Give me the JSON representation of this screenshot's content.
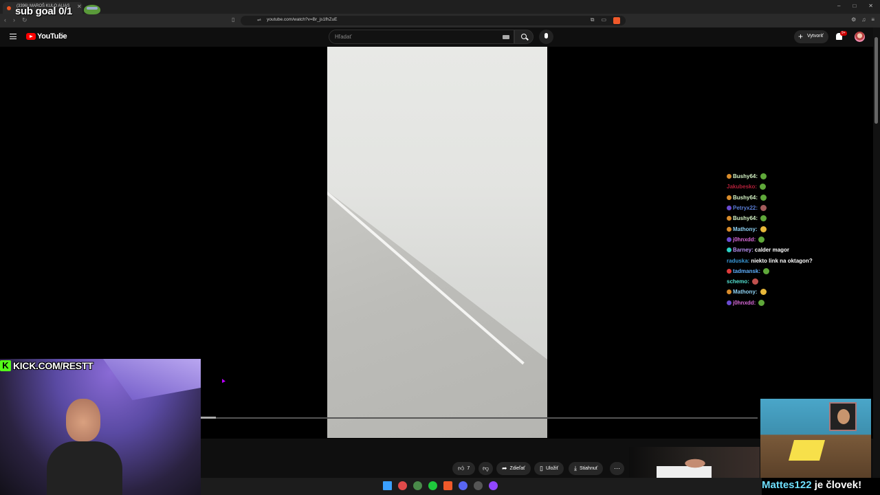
{
  "browser": {
    "tab_title": "(3396) MAROŠ KULO ALIAS",
    "url": "youtube.com/watch?v=Br_js1fhZuE",
    "window_controls": [
      "–",
      "□",
      "✕"
    ]
  },
  "youtube": {
    "brand": "YouTube",
    "country": "SK",
    "search_placeholder": "Hľadať",
    "create_label": "Vytvoriť",
    "notif_badge": "9+"
  },
  "video_actions": {
    "like_count": "7",
    "share_label": "Zdieľať",
    "save_label": "Uložiť",
    "download_label": "Stiahnuť"
  },
  "overlay": {
    "sub_goal": "sub goal 0/1",
    "kick_url": "KICK.COM/RESTT",
    "mattes_name": "Mattes122",
    "mattes_text": " je človek!"
  },
  "chat": [
    {
      "user": "Bushy64:",
      "color": "#d6f5c6",
      "badge": "#d98c2b",
      "msg": "",
      "emote": "#5fa83a"
    },
    {
      "user": "Jakubesko:",
      "color": "#b3203a",
      "badge": "",
      "msg": "",
      "emote": "#5fa83a"
    },
    {
      "user": "Bushy64:",
      "color": "#d6f5c6",
      "badge": "#d98c2b",
      "msg": "",
      "emote": "#5fa83a"
    },
    {
      "user": "Petryx22:",
      "color": "#5b7fd8",
      "badge": "#6a4bd1",
      "msg": "",
      "emote": "#a25b5b"
    },
    {
      "user": "Bushy64:",
      "color": "#d6f5c6",
      "badge": "#d98c2b",
      "msg": "",
      "emote": "#5fa83a"
    },
    {
      "user": "Mathony:",
      "color": "#8fd3f5",
      "badge": "#d98c2b",
      "msg": "",
      "emote": "#e8b83a"
    },
    {
      "user": "j0hnxdd:",
      "color": "#d86ad8",
      "badge": "#6a4bd1",
      "msg": "",
      "emote": "#5fa83a"
    },
    {
      "user": "Barney:",
      "color": "#b58ff0",
      "badge": "#2ad1c4",
      "msg": "calder magor",
      "emote": ""
    },
    {
      "user": "raduska:",
      "color": "#3a9ad9",
      "badge": "",
      "msg": "niekto link na oktagon?",
      "emote": ""
    },
    {
      "user": "tadmansk:",
      "color": "#5fb0ff",
      "badge": "#e03b3b",
      "msg": "",
      "emote": "#5fa83a"
    },
    {
      "user": "schemo:",
      "color": "#53e0d0",
      "badge": "",
      "msg": "",
      "emote": "#c0504d"
    },
    {
      "user": "Mathony:",
      "color": "#8fd3f5",
      "badge": "#d98c2b",
      "msg": "",
      "emote": "#e8b83a"
    },
    {
      "user": "j0hnxdd:",
      "color": "#d86ad8",
      "badge": "#6a4bd1",
      "msg": "",
      "emote": "#5fa83a"
    }
  ],
  "taskbar_icons": [
    "windows-start",
    "maps-pin",
    "xbox",
    "green-app",
    "brave",
    "discord",
    "obs",
    "twitch"
  ],
  "taskbar_colors": [
    "#3aa0ff",
    "#e04a4a",
    "#4a8a4a",
    "#1ec83c",
    "#f0592a",
    "#5865f2",
    "#555",
    "#9146ff"
  ],
  "video_progress": 0.027
}
